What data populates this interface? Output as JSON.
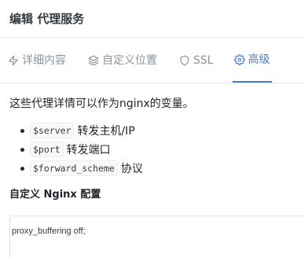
{
  "modal": {
    "title": "编辑 代理服务"
  },
  "tabs": [
    {
      "label": "详细内容",
      "icon": "bolt-icon",
      "active": false
    },
    {
      "label": "自定义位置",
      "icon": "layers-icon",
      "active": false
    },
    {
      "label": "SSL",
      "icon": "shield-icon",
      "active": false
    },
    {
      "label": "高级",
      "icon": "gear-icon",
      "active": true
    }
  ],
  "body": {
    "intro": "这些代理详情可以作为nginx的变量。",
    "variables": [
      {
        "code": "$server",
        "description": "转发主机/IP"
      },
      {
        "code": "$port",
        "description": "转发端口"
      },
      {
        "code": "$forward_scheme",
        "description": "协议"
      }
    ],
    "config_label": "自定义 Nginx 配置",
    "config_value": "proxy_buffering off;"
  },
  "colors": {
    "accent": "#467fcf",
    "muted": "#8a949e"
  }
}
